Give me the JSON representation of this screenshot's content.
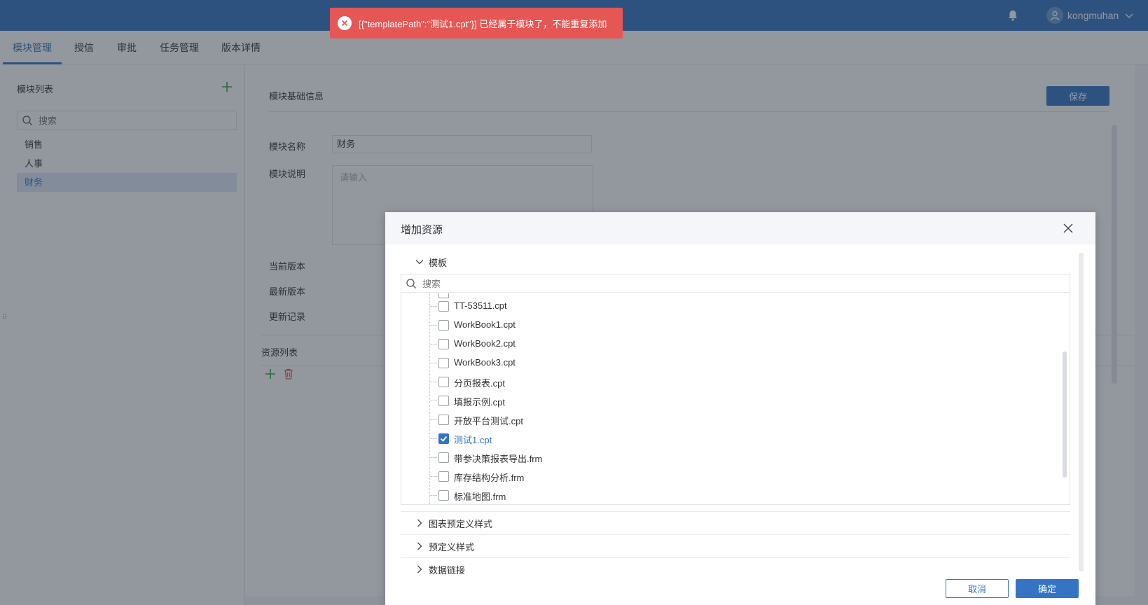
{
  "header": {
    "username": "kongmuhan",
    "icons": {
      "notification": "bell-icon",
      "user": "user-avatar-icon",
      "menu": "chevron-down-icon"
    }
  },
  "tabs": [
    {
      "label": "模块管理",
      "active": true
    },
    {
      "label": "授信",
      "active": false
    },
    {
      "label": "审批",
      "active": false
    },
    {
      "label": "任务管理",
      "active": false
    },
    {
      "label": "版本详情",
      "active": false
    }
  ],
  "module_list": {
    "title": "模块列表",
    "search_placeholder": "搜索",
    "items": [
      {
        "label": "销售",
        "selected": false
      },
      {
        "label": "人事",
        "selected": false
      },
      {
        "label": "财务",
        "selected": true
      }
    ]
  },
  "module_info": {
    "section_title": "模块基础信息",
    "save_label": "保存",
    "name_label": "模块名称",
    "name_value": "财务",
    "desc_label": "模块说明",
    "desc_placeholder": "请输入",
    "current_version_label": "当前版本",
    "latest_version_label": "最新版本",
    "update_log_label": "更新记录"
  },
  "resource_list": {
    "title": "资源列表"
  },
  "toast": {
    "type": "error",
    "message": "[{\"templatePath\":\"测试1.cpt\"}] 已经属于模块了，不能重复添加"
  },
  "dialog": {
    "title": "增加资源",
    "groups": [
      {
        "label": "模板",
        "expanded": true
      },
      {
        "label": "图表预定义样式",
        "expanded": false
      },
      {
        "label": "预定义样式",
        "expanded": false
      },
      {
        "label": "数据链接",
        "expanded": false
      }
    ],
    "search_placeholder": "搜索",
    "templates": [
      {
        "name": "TT-53511.cpt",
        "checked": false
      },
      {
        "name": "WorkBook1.cpt",
        "checked": false
      },
      {
        "name": "WorkBook2.cpt",
        "checked": false
      },
      {
        "name": "WorkBook3.cpt",
        "checked": false
      },
      {
        "name": "分页报表.cpt",
        "checked": false
      },
      {
        "name": "填报示例.cpt",
        "checked": false
      },
      {
        "name": "开放平台测试.cpt",
        "checked": false
      },
      {
        "name": "测试1.cpt",
        "checked": true
      },
      {
        "name": "带参决策报表导出.frm",
        "checked": false
      },
      {
        "name": "库存结构分析.frm",
        "checked": false
      },
      {
        "name": "标准地图.frm",
        "checked": false
      }
    ],
    "cancel_label": "取消",
    "ok_label": "确定"
  },
  "colors": {
    "primary": "#3574c3",
    "error": "#e55755",
    "add_green": "#2fa84f",
    "delete_red": "#e55755"
  }
}
